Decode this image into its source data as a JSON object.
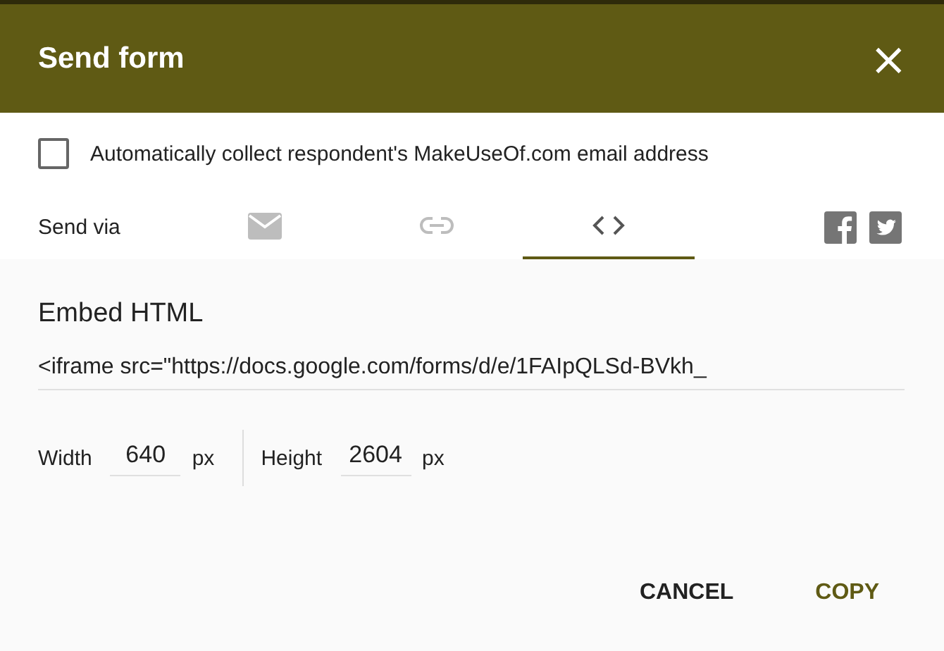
{
  "window": {
    "title": "Send form",
    "close": "×"
  },
  "collect_email": {
    "label": "Automatically collect respondent's MakeUseOf.com email address",
    "checked": false
  },
  "send_via": {
    "label": "Send via",
    "tabs": [
      {
        "kind": "email",
        "selected": false
      },
      {
        "kind": "link",
        "selected": false
      },
      {
        "kind": "embed",
        "selected": true
      }
    ],
    "social": [
      {
        "kind": "facebook"
      },
      {
        "kind": "twitter"
      }
    ]
  },
  "embed": {
    "heading": "Embed HTML",
    "code": "<iframe src=\"https://docs.google.com/forms/d/e/1FAIpQLSd-BVkh_",
    "width": {
      "label": "Width",
      "value": "640",
      "unit": "px"
    },
    "height": {
      "label": "Height",
      "value": "2604",
      "unit": "px"
    }
  },
  "buttons": [
    {
      "label": "CANCEL",
      "kind": "plain"
    },
    {
      "label": "COPY",
      "kind": "primary"
    }
  ]
}
